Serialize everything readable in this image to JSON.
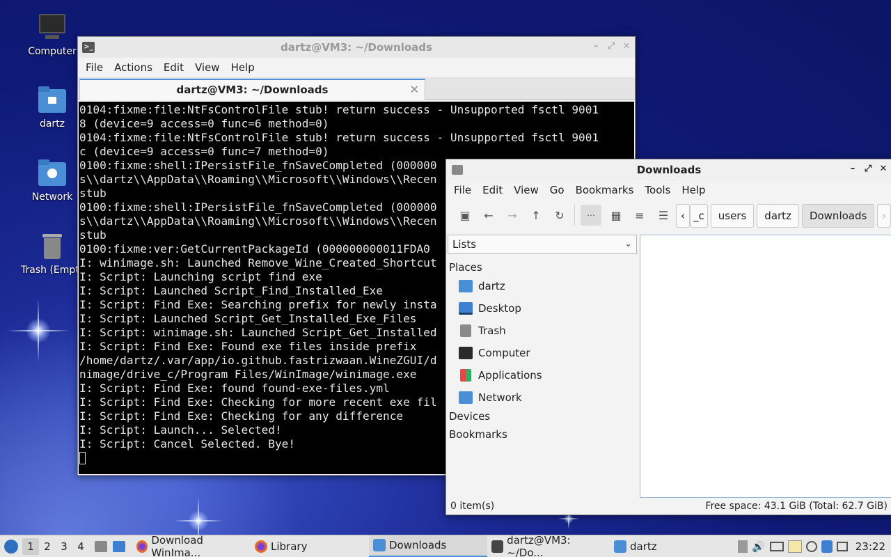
{
  "desktop_icons": [
    {
      "label": "Computer",
      "icon": "computer-icon"
    },
    {
      "label": "dartz",
      "icon": "home-folder-icon"
    },
    {
      "label": "Network",
      "icon": "network-folder-icon"
    },
    {
      "label": "Trash (Empty)",
      "icon": "trash-icon"
    }
  ],
  "terminal": {
    "title": "dartz@VM3: ~/Downloads",
    "menu": [
      "File",
      "Actions",
      "Edit",
      "View",
      "Help"
    ],
    "tab_label": "dartz@VM3: ~/Downloads",
    "lines": [
      "0104:fixme:file:NtFsControlFile stub! return success - Unsupported fsctl 9001",
      "8 (device=9 access=0 func=6 method=0)",
      "0104:fixme:file:NtFsControlFile stub! return success - Unsupported fsctl 9001",
      "c (device=9 access=0 func=7 method=0)",
      "0100:fixme:shell:IPersistFile_fnSaveCompleted (000000",
      "s\\\\dartz\\\\AppData\\\\Roaming\\\\Microsoft\\\\Windows\\\\Recen",
      "stub",
      "0100:fixme:shell:IPersistFile_fnSaveCompleted (000000",
      "s\\\\dartz\\\\AppData\\\\Roaming\\\\Microsoft\\\\Windows\\\\Recen",
      "stub",
      "0100:fixme:ver:GetCurrentPackageId (000000000011FDA0",
      "I: winimage.sh: Launched Remove_Wine_Created_Shortcut",
      "I: Script: Launching script find exe",
      "I: Script: Launched Script_Find_Installed_Exe",
      "I: Script: Find Exe: Searching prefix for newly insta",
      "I: Script: Launched Script_Get_Installed_Exe_Files",
      "I: Script: winimage.sh: Launched Script_Get_Installed",
      "I: Script: Find Exe: Found exe files inside prefix",
      "/home/dartz/.var/app/io.github.fastrizwaan.WineZGUI/d",
      "nimage/drive_c/Program Files/WinImage/winimage.exe",
      "I: Script: Find Exe: found found-exe-files.yml",
      "I: Script: Find Exe: Checking for more recent exe fil",
      "I: Script: Find Exe: Checking for any difference",
      "I: Script: Launch... Selected!",
      "I: Script: Cancel Selected. Bye!"
    ]
  },
  "file_manager": {
    "title": "Downloads",
    "menu": [
      "File",
      "Edit",
      "View",
      "Go",
      "Bookmarks",
      "Tools",
      "Help"
    ],
    "breadcrumbs": [
      "_c",
      "users",
      "dartz",
      "Downloads"
    ],
    "side_pane_mode": "Lists",
    "places_header": "Places",
    "places": [
      {
        "label": "dartz",
        "icon": "home-folder-icon"
      },
      {
        "label": "Desktop",
        "icon": "desktop-icon"
      },
      {
        "label": "Trash",
        "icon": "trash-icon"
      },
      {
        "label": "Computer",
        "icon": "computer-icon"
      },
      {
        "label": "Applications",
        "icon": "applications-icon"
      },
      {
        "label": "Network",
        "icon": "network-icon"
      }
    ],
    "devices_header": "Devices",
    "bookmarks_header": "Bookmarks",
    "status_items": "0 item(s)",
    "status_free": "Free space: 43.1 GiB (Total: 62.7 GiB)"
  },
  "taskbar": {
    "workspaces": [
      "1",
      "2",
      "3",
      "4"
    ],
    "current_workspace": "1",
    "tasks": [
      {
        "label": "Download WinIma...",
        "icon": "firefox-icon"
      },
      {
        "label": "Library",
        "icon": "firefox-icon"
      },
      {
        "label": "Downloads",
        "icon": "folder-icon",
        "active": true
      },
      {
        "label": "dartz@VM3: ~/Do...",
        "icon": "terminal-icon"
      },
      {
        "label": "dartz",
        "icon": "folder-icon"
      }
    ],
    "clock": "23:22"
  },
  "colors": {
    "accent": "#4f8fd8",
    "folder": "#4a8fd6",
    "terminal_bg": "#000000"
  }
}
